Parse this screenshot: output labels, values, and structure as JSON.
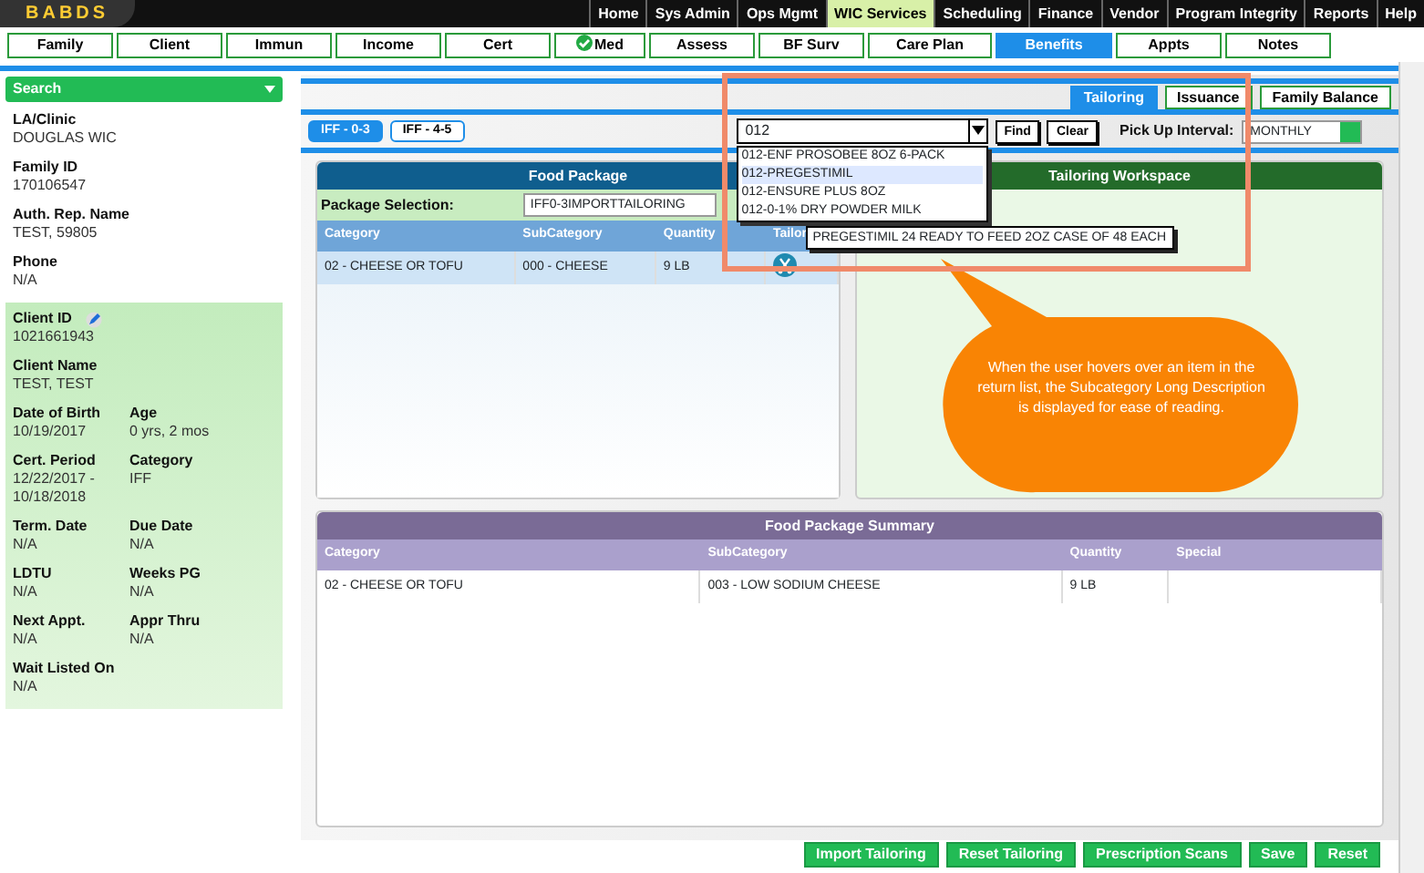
{
  "logo": {
    "text": "BABDS"
  },
  "top_menu": [
    {
      "label": "Home",
      "selected": false
    },
    {
      "label": "Sys Admin",
      "selected": false
    },
    {
      "label": "Ops Mgmt",
      "selected": false
    },
    {
      "label": "WIC Services",
      "selected": true
    },
    {
      "label": "Scheduling",
      "selected": false
    },
    {
      "label": "Finance",
      "selected": false
    },
    {
      "label": "Vendor",
      "selected": false
    },
    {
      "label": "Program Integrity",
      "selected": false
    },
    {
      "label": "Reports",
      "selected": false
    },
    {
      "label": "Help",
      "selected": false
    }
  ],
  "tabs": [
    {
      "label": "Family",
      "selected": false,
      "checked": false
    },
    {
      "label": "Client",
      "selected": false,
      "checked": false
    },
    {
      "label": "Immun",
      "selected": false,
      "checked": false
    },
    {
      "label": "Income",
      "selected": false,
      "checked": false
    },
    {
      "label": "Cert",
      "selected": false,
      "checked": false
    },
    {
      "label": "Med",
      "selected": false,
      "checked": true
    },
    {
      "label": "Assess",
      "selected": false,
      "checked": false
    },
    {
      "label": "BF Surv",
      "selected": false,
      "checked": false
    },
    {
      "label": "Care Plan",
      "selected": false,
      "checked": false
    },
    {
      "label": "Benefits",
      "selected": true,
      "checked": false
    },
    {
      "label": "Appts",
      "selected": false,
      "checked": false
    },
    {
      "label": "Notes",
      "selected": false,
      "checked": false
    }
  ],
  "sidebar": {
    "search": "Search",
    "family_fields": [
      {
        "label": "LA/Clinic",
        "value": "DOUGLAS WIC"
      },
      {
        "label": "Family ID",
        "value": "170106547"
      },
      {
        "label": "Auth. Rep. Name",
        "value": "TEST, 59805"
      },
      {
        "label": "Phone",
        "value": "N/A"
      }
    ],
    "client_fields": [
      [
        {
          "label": "Client ID",
          "value": "1021661943",
          "editable": true
        }
      ],
      [
        {
          "label": "Client Name",
          "value": "TEST, TEST",
          "editable": false
        }
      ],
      [
        {
          "label": "Date of Birth",
          "value": "10/19/2017",
          "editable": false
        },
        {
          "label": "Age",
          "value": "0 yrs, 2 mos",
          "editable": false
        }
      ],
      [
        {
          "label": "Cert. Period",
          "value": "12/22/2017 - 10/18/2018",
          "editable": false
        },
        {
          "label": "Category",
          "value": "IFF",
          "editable": false
        }
      ],
      [
        {
          "label": "Term. Date",
          "value": "N/A",
          "editable": false
        },
        {
          "label": "Due Date",
          "value": "N/A",
          "editable": false
        }
      ],
      [
        {
          "label": "LDTU",
          "value": "N/A",
          "editable": false
        },
        {
          "label": "Weeks PG",
          "value": "N/A",
          "editable": false
        }
      ],
      [
        {
          "label": "Next Appt.",
          "value": "N/A",
          "editable": false
        },
        {
          "label": "Appr Thru",
          "value": "N/A",
          "editable": false
        }
      ],
      [
        {
          "label": "Wait Listed On",
          "value": "N/A",
          "editable": false
        }
      ]
    ]
  },
  "view_tabs": [
    {
      "label": "Tailoring",
      "selected": true
    },
    {
      "label": "Issuance",
      "selected": false
    },
    {
      "label": "Family Balance",
      "selected": false
    }
  ],
  "package_tabs": [
    {
      "label": "IFF - 0-3",
      "selected": true
    },
    {
      "label": "IFF - 4-5",
      "selected": false
    }
  ],
  "search_box": {
    "value": "012",
    "find": "Find",
    "clear": "Clear",
    "options": [
      {
        "label": "012-ENF PROSOBEE 8OZ 6-PACK",
        "hovered": false
      },
      {
        "label": "012-PREGESTIMIL",
        "hovered": true
      },
      {
        "label": "012-ENSURE PLUS 8OZ",
        "hovered": false
      },
      {
        "label": "012-0-1% DRY POWDER MILK",
        "hovered": false
      }
    ],
    "tooltip": "PREGESTIMIL 24 READY TO FEED 2OZ CASE OF 48 EACH"
  },
  "pickup": {
    "label": "Pick Up Interval:",
    "value": "MONTHLY"
  },
  "food_package": {
    "title": "Food Package",
    "selection_label": "Package Selection:",
    "selection_value": "IFF0-3IMPORTTAILORING",
    "columns": [
      "Category",
      "SubCategory",
      "Quantity",
      "Tailor"
    ],
    "rows": [
      {
        "category": "02 - CHEESE OR TOFU",
        "subcategory": "000 - CHEESE",
        "quantity": "9 LB"
      }
    ]
  },
  "workspace": {
    "title": "Tailoring Workspace"
  },
  "summary": {
    "title": "Food Package Summary",
    "columns": [
      "Category",
      "SubCategory",
      "Quantity",
      "Special"
    ],
    "rows": [
      {
        "category": "02 - CHEESE OR TOFU",
        "subcategory": "003 - LOW SODIUM CHEESE",
        "quantity": "9 LB"
      }
    ]
  },
  "callout": "When the user hovers over an item in the return list, the Subcategory Long Description is displayed for ease of reading.",
  "buttons": [
    "Import Tailoring",
    "Reset Tailoring",
    "Prescription Scans",
    "Save",
    "Reset"
  ]
}
